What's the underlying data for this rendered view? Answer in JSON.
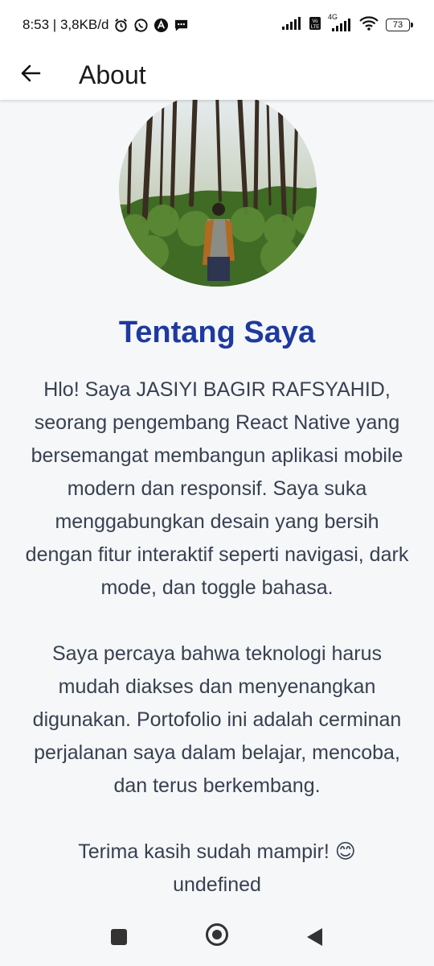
{
  "status_bar": {
    "time_speed": "8:53 | 3,8KB/d",
    "icons": [
      "alarm-icon",
      "whatsapp-icon",
      "app-icon",
      "message-icon",
      "signal-icon",
      "volte-icon",
      "4g-signal-icon",
      "wifi-icon"
    ],
    "network_label": "4G",
    "battery": "73"
  },
  "header": {
    "back_icon": "arrow-left-icon",
    "title": "About"
  },
  "profile": {
    "image_icon": "profile-photo-forest"
  },
  "about": {
    "heading": "Tentang Saya",
    "heading_color": "#1e3a9e",
    "text": "Hlo! Saya JASIYI BAGIR RAFSYAHID, seorang pengembang React Native yang bersemangat membangun aplikasi mobile modern dan responsif. Saya suka menggabungkan desain yang bersih dengan fitur interaktif seperti navigasi, dark mode, dan toggle bahasa.\n\nSaya percaya bahwa teknologi harus mudah diakses dan menyenangkan digunakan. Portofolio ini adalah cerminan perjalanan saya dalam belajar, mencoba, dan terus berkembang.\n\nTerima kasih sudah mampir! 😊\nundefined"
  },
  "nav_bar": {
    "icons": [
      "recents-square-icon",
      "home-circle-icon",
      "back-triangle-icon"
    ]
  }
}
